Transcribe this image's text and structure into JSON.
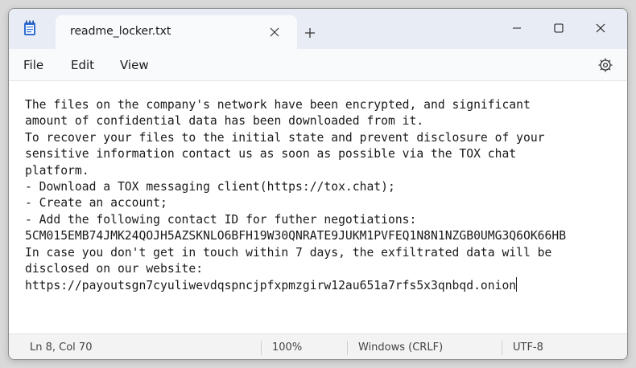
{
  "window": {
    "tab_title": "readme_locker.txt",
    "icons": {
      "app": "notepad-icon",
      "tab_close": "close-icon",
      "new_tab": "plus-icon",
      "minimize": "minimize-icon",
      "maximize": "maximize-icon",
      "close": "close-icon",
      "settings": "gear-icon"
    }
  },
  "menu": {
    "file": "File",
    "edit": "Edit",
    "view": "View"
  },
  "document": {
    "lines": [
      "The files on the company's network have been encrypted, and significant",
      "amount of confidential data has been downloaded from it.",
      "To recover your files to the initial state and prevent disclosure of your",
      "sensitive information contact us as soon as possible via the TOX chat",
      "platform.",
      "- Download a TOX messaging client(https://tox.chat);",
      "- Create an account;",
      "- Add the following contact ID for futher negotiations:",
      "5CM015EMB74JMK24QOJH5AZSKNLO6BFH19W30QNRATE9JUKM1PVFEQ1N8N1NZGB0UMG3Q6OK66HB",
      "In case you don't get in touch within 7 days, the exfiltrated data will be",
      "disclosed on our website:",
      "https://payoutsgn7cyuliwevdqspncjpfxpmzgirw12au651a7rfs5x3qnbqd.onion"
    ]
  },
  "status": {
    "position": "Ln 8, Col 70",
    "zoom": "100%",
    "line_ending": "Windows (CRLF)",
    "encoding": "UTF-8"
  },
  "colors": {
    "titlebar": "#e8ecf4",
    "tab": "#f9fafc",
    "text": "#1a1a1a",
    "statusbar": "#f3f3f3",
    "app_icon": "#2f6fd6"
  }
}
